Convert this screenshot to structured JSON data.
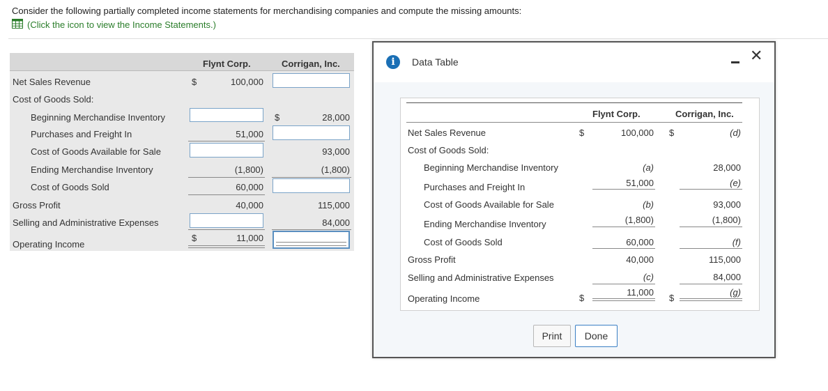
{
  "question": "Consider the following partially completed income statements for merchandising companies and compute the missing amounts:",
  "link_text": "(Click the icon to view the Income Statements.)",
  "main": {
    "col1": "Flynt Corp.",
    "col2": "Corrigan, Inc.",
    "rows": {
      "net_sales": {
        "label": "Net Sales Revenue",
        "flynt_cur": "$",
        "flynt": "100,000"
      },
      "cogs_header": {
        "label": "Cost of Goods Sold:"
      },
      "beg_inv": {
        "label": "Beginning Merchandise Inventory",
        "corr_cur": "$",
        "corr": "28,000"
      },
      "purchases": {
        "label": "Purchases and Freight In",
        "flynt": "51,000"
      },
      "available": {
        "label": "Cost of Goods Available for Sale",
        "corr": "93,000"
      },
      "ending_inv": {
        "label": "Ending Merchandise Inventory",
        "flynt": "(1,800)",
        "corr": "(1,800)"
      },
      "cogs": {
        "label": "Cost of Goods Sold",
        "flynt": "60,000"
      },
      "gross_profit": {
        "label": "Gross Profit",
        "flynt": "40,000",
        "corr": "115,000"
      },
      "sga": {
        "label": "Selling and Administrative Expenses",
        "corr": "84,000"
      },
      "op_income": {
        "label": "Operating Income",
        "flynt_cur": "$",
        "flynt": "11,000"
      }
    }
  },
  "modal": {
    "title": "Data Table",
    "col1": "Flynt Corp.",
    "col2": "Corrigan, Inc.",
    "rows": {
      "net_sales": {
        "label": "Net Sales Revenue",
        "cur1": "$",
        "v1": "100,000",
        "cur2": "$",
        "v2": "(d)"
      },
      "cogs_header": {
        "label": "Cost of Goods Sold:"
      },
      "beg_inv": {
        "label": "Beginning Merchandise Inventory",
        "v1": "(a)",
        "v2": "28,000"
      },
      "purchases": {
        "label": "Purchases and Freight In",
        "v1": "51,000",
        "v2": "(e)"
      },
      "available": {
        "label": "Cost of Goods Available for Sale",
        "v1": "(b)",
        "v2": "93,000"
      },
      "ending_inv": {
        "label": "Ending Merchandise Inventory",
        "v1": "(1,800)",
        "v2": "(1,800)"
      },
      "cogs": {
        "label": "Cost of Goods Sold",
        "v1": "60,000",
        "v2": "(f)"
      },
      "gross_profit": {
        "label": "Gross Profit",
        "v1": "40,000",
        "v2": "115,000"
      },
      "sga": {
        "label": "Selling and Administrative Expenses",
        "v1": "(c)",
        "v2": "84,000"
      },
      "op_income": {
        "label": "Operating Income",
        "cur1": "$",
        "v1": "11,000",
        "cur2": "$",
        "v2": "(g)"
      }
    },
    "print_label": "Print",
    "done_label": "Done"
  }
}
